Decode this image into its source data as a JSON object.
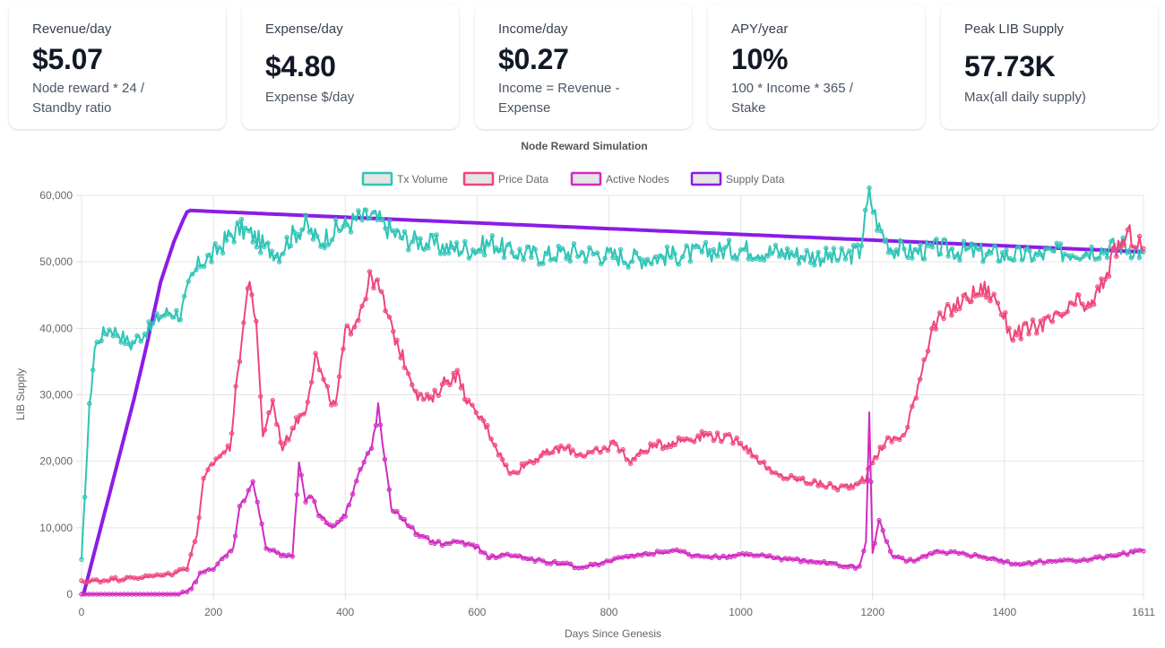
{
  "cards": [
    {
      "label": "Revenue/day",
      "value": "$5.07",
      "desc_lines": [
        "Node reward * 24 /",
        "Standby ratio"
      ]
    },
    {
      "label": "Expense/day",
      "value": "$4.80",
      "desc_lines": [
        "Expense $/day"
      ]
    },
    {
      "label": "Income/day",
      "value": "$0.27",
      "desc_lines": [
        "Income = Revenue -",
        "Expense"
      ]
    },
    {
      "label": "APY/year",
      "value": "10%",
      "desc_lines": [
        "100 * Income * 365 /",
        "Stake"
      ]
    },
    {
      "label": "Peak LIB Supply",
      "value": "57.73K",
      "desc_lines": [
        "Max(all daily supply)"
      ]
    }
  ],
  "chart_data": {
    "type": "line",
    "title": "Node Reward Simulation",
    "xlabel": "Days Since Genesis",
    "ylabel": "LIB Supply",
    "xlim": [
      0,
      1611
    ],
    "ylim": [
      0,
      60000
    ],
    "x_ticks": [
      "0",
      "200",
      "400",
      "600",
      "800",
      "1000",
      "1200",
      "1400",
      "1611"
    ],
    "y_ticks": [
      "0",
      "10,000",
      "20,000",
      "30,000",
      "40,000",
      "50,000",
      "60,000"
    ],
    "grid": true,
    "legend_position": "top",
    "series": [
      {
        "name": "Tx Volume",
        "color": "#2ec4b6",
        "x": [
          0,
          5,
          12,
          20,
          30,
          45,
          60,
          75,
          90,
          105,
          120,
          135,
          150,
          165,
          180,
          200,
          220,
          240,
          260,
          280,
          300,
          320,
          340,
          360,
          380,
          400,
          420,
          440,
          455,
          470,
          490,
          520,
          560,
          600,
          620,
          650,
          700,
          750,
          800,
          850,
          900,
          950,
          1000,
          1050,
          1100,
          1150,
          1180,
          1195,
          1210,
          1230,
          1260,
          1300,
          1350,
          1400,
          1450,
          1500,
          1550,
          1580,
          1611
        ],
        "values": [
          5000,
          15000,
          28000,
          37000,
          39000,
          40000,
          39000,
          37500,
          39000,
          40000,
          42000,
          42500,
          42000,
          47000,
          50000,
          51000,
          53500,
          55000,
          54000,
          52000,
          51500,
          54000,
          55500,
          53000,
          54500,
          55500,
          56500,
          56800,
          56000,
          54500,
          53500,
          53000,
          52000,
          52000,
          53000,
          51500,
          51000,
          51500,
          51000,
          50500,
          51000,
          51500,
          52000,
          51500,
          51000,
          50500,
          51500,
          60000,
          55000,
          52000,
          51500,
          52000,
          51500,
          51000,
          51000,
          51500,
          52000,
          52500,
          51500
        ]
      },
      {
        "name": "Price Data",
        "color": "#f0457a",
        "x": [
          0,
          20,
          40,
          60,
          80,
          100,
          120,
          140,
          160,
          175,
          185,
          195,
          210,
          225,
          240,
          255,
          265,
          275,
          290,
          305,
          320,
          340,
          355,
          370,
          385,
          400,
          420,
          440,
          455,
          470,
          490,
          510,
          530,
          550,
          570,
          590,
          610,
          630,
          650,
          680,
          700,
          730,
          760,
          790,
          810,
          830,
          860,
          900,
          950,
          1000,
          1050,
          1100,
          1150,
          1170,
          1190,
          1200,
          1220,
          1250,
          1260,
          1290,
          1320,
          1350,
          1370,
          1390,
          1410,
          1440,
          1470,
          1490,
          1510,
          1530,
          1550,
          1570,
          1590,
          1611
        ],
        "values": [
          1800,
          2000,
          2200,
          2300,
          2500,
          2600,
          2800,
          3200,
          4000,
          9000,
          17000,
          19000,
          21000,
          22000,
          36000,
          48000,
          40000,
          24000,
          29000,
          22000,
          25000,
          28000,
          36000,
          31000,
          28000,
          39000,
          42000,
          48000,
          45000,
          40000,
          35000,
          30000,
          29000,
          32000,
          33000,
          28000,
          26000,
          22000,
          18000,
          20000,
          21000,
          22000,
          21000,
          21500,
          23000,
          20000,
          22000,
          23000,
          24000,
          23000,
          18000,
          17000,
          16000,
          16500,
          17500,
          20000,
          23000,
          24000,
          28000,
          40000,
          43000,
          45000,
          46000,
          44000,
          39000,
          40000,
          41000,
          42000,
          44000,
          43000,
          47000,
          52000,
          54000,
          52000
        ]
      },
      {
        "name": "Active Nodes",
        "color": "#d12bc1",
        "x": [
          0,
          50,
          100,
          150,
          160,
          170,
          180,
          190,
          200,
          210,
          220,
          230,
          240,
          250,
          260,
          270,
          280,
          300,
          320,
          330,
          340,
          350,
          360,
          380,
          400,
          420,
          440,
          450,
          460,
          470,
          490,
          510,
          530,
          550,
          570,
          600,
          620,
          640,
          670,
          700,
          730,
          760,
          800,
          850,
          900,
          950,
          1000,
          1050,
          1100,
          1150,
          1180,
          1190,
          1195,
          1200,
          1210,
          1230,
          1260,
          1300,
          1340,
          1380,
          1420,
          1460,
          1500,
          1550,
          1611
        ],
        "values": [
          0,
          0,
          0,
          0,
          200,
          1500,
          3000,
          4000,
          3500,
          5000,
          6000,
          7000,
          13000,
          15000,
          17000,
          12000,
          7000,
          6000,
          5500,
          20000,
          14000,
          15000,
          12000,
          10000,
          12000,
          18000,
          22000,
          28000,
          20000,
          13000,
          11000,
          9000,
          8000,
          7500,
          8000,
          7000,
          5500,
          6000,
          5500,
          5000,
          4500,
          4000,
          5000,
          6000,
          6500,
          5500,
          6000,
          5500,
          5000,
          4500,
          4000,
          8000,
          27000,
          6000,
          11000,
          5500,
          5000,
          6500,
          6000,
          5500,
          4500,
          5000,
          5000,
          5500,
          6500
        ]
      },
      {
        "name": "Supply Data",
        "color": "#8b1ce6",
        "x": [
          0,
          3,
          20,
          50,
          80,
          100,
          120,
          140,
          155,
          160,
          165,
          1611
        ],
        "values": [
          0,
          0,
          6500,
          18000,
          29500,
          38000,
          47000,
          53000,
          56500,
          57500,
          57730,
          51500
        ]
      }
    ]
  }
}
